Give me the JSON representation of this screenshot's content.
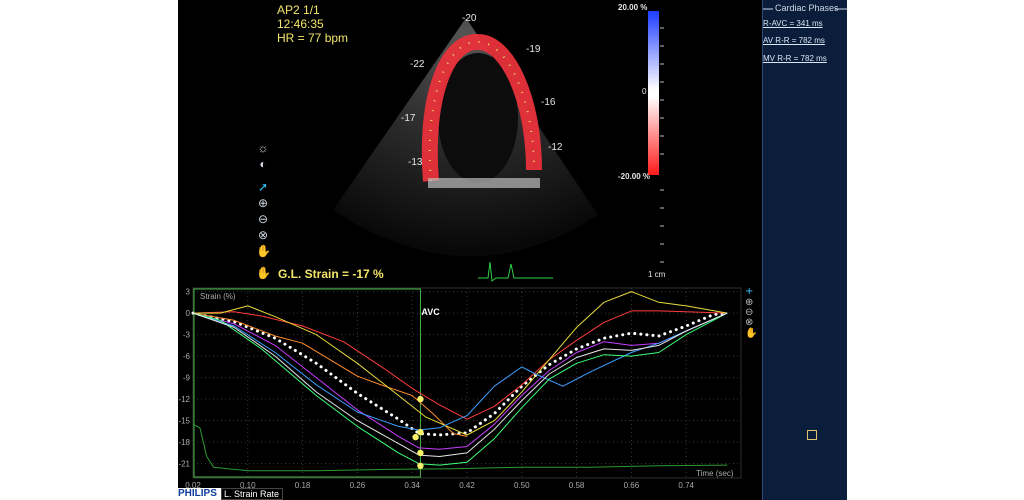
{
  "header": {
    "view": "AP2  1/1",
    "time": "12:46:35",
    "hr": "HR = 77 bpm"
  },
  "segments": [
    "-20",
    "-19",
    "-22",
    "-16",
    "-17",
    "-12",
    "-13"
  ],
  "colorbar": {
    "max_label": "20.00 %",
    "mid_label": "0",
    "min_label": "-20.00 %",
    "top_color": "#1e3cff",
    "bottom_color": "#ff1a1a"
  },
  "scale_label": "1 cm",
  "gls": "G.L. Strain = -17 %",
  "tools": [
    "brightness-icon",
    "contrast-icon",
    "pointer-icon",
    "zoom-in-icon",
    "zoom-out-icon",
    "reset-icon",
    "pan-hand-icon"
  ],
  "chart_data": {
    "type": "line",
    "ylabel": "Strain (%)",
    "xlabel": "Time (sec)",
    "avc_label": "AVC",
    "avc_x": 0.352,
    "xlim": [
      0.02,
      0.82
    ],
    "ylim": [
      -23,
      3.5
    ],
    "x_ticks": [
      "0.02",
      "0.10",
      "0.18",
      "0.26",
      "0.34",
      "0.42",
      "0.50",
      "0.58",
      "0.66",
      "0.74"
    ],
    "y_ticks": [
      "3",
      "0",
      "-3",
      "-6",
      "-9",
      "-12",
      "-15",
      "-18",
      "-21"
    ],
    "series": [
      {
        "color": "#ffffff",
        "dotted": true,
        "points": [
          [
            0.02,
            0
          ],
          [
            0.08,
            -1.2
          ],
          [
            0.14,
            -3.5
          ],
          [
            0.2,
            -7
          ],
          [
            0.26,
            -11.2
          ],
          [
            0.32,
            -14.8
          ],
          [
            0.35,
            -16.8
          ],
          [
            0.38,
            -17
          ],
          [
            0.42,
            -16.7
          ],
          [
            0.46,
            -14
          ],
          [
            0.5,
            -10.2
          ],
          [
            0.54,
            -7.2
          ],
          [
            0.58,
            -5
          ],
          [
            0.62,
            -3.5
          ],
          [
            0.66,
            -2.8
          ],
          [
            0.7,
            -3.2
          ],
          [
            0.74,
            -1.8
          ],
          [
            0.78,
            -0.2
          ],
          [
            0.8,
            0
          ]
        ]
      },
      {
        "color": "#ff3c3c",
        "points": [
          [
            0.02,
            0
          ],
          [
            0.08,
            0.2
          ],
          [
            0.12,
            -0.4
          ],
          [
            0.18,
            -1.8
          ],
          [
            0.24,
            -4
          ],
          [
            0.3,
            -7.8
          ],
          [
            0.34,
            -10.5
          ],
          [
            0.38,
            -12.8
          ],
          [
            0.42,
            -14.8
          ],
          [
            0.46,
            -13
          ],
          [
            0.5,
            -10
          ],
          [
            0.54,
            -6.5
          ],
          [
            0.58,
            -3.8
          ],
          [
            0.62,
            -1.3
          ],
          [
            0.66,
            0.3
          ],
          [
            0.7,
            0.3
          ],
          [
            0.74,
            0.2
          ],
          [
            0.8,
            0
          ]
        ]
      },
      {
        "color": "#ff8c2a",
        "points": [
          [
            0.02,
            0
          ],
          [
            0.08,
            -1
          ],
          [
            0.14,
            -3.2
          ],
          [
            0.18,
            -4.2
          ],
          [
            0.22,
            -6.5
          ],
          [
            0.26,
            -8.8
          ],
          [
            0.3,
            -10.2
          ],
          [
            0.34,
            -11.5
          ],
          [
            0.37,
            -14
          ],
          [
            0.4,
            -16.8
          ],
          [
            0.42,
            -17.2
          ]
        ]
      },
      {
        "color": "#e8dc3c",
        "points": [
          [
            0.02,
            0
          ],
          [
            0.06,
            0
          ],
          [
            0.1,
            1
          ],
          [
            0.14,
            -0.5
          ],
          [
            0.2,
            -3
          ],
          [
            0.26,
            -7
          ],
          [
            0.32,
            -11.5
          ],
          [
            0.36,
            -14.5
          ],
          [
            0.42,
            -17
          ],
          [
            0.46,
            -15
          ],
          [
            0.5,
            -11
          ],
          [
            0.54,
            -6.5
          ],
          [
            0.58,
            -2
          ],
          [
            0.62,
            1.5
          ],
          [
            0.66,
            3
          ],
          [
            0.7,
            1.5
          ],
          [
            0.74,
            1
          ],
          [
            0.8,
            0
          ]
        ]
      },
      {
        "color": "#c83cff",
        "points": [
          [
            0.02,
            0
          ],
          [
            0.08,
            -1.5
          ],
          [
            0.14,
            -4.5
          ],
          [
            0.2,
            -9
          ],
          [
            0.26,
            -13.5
          ],
          [
            0.32,
            -17.2
          ],
          [
            0.35,
            -18.8
          ],
          [
            0.38,
            -19
          ],
          [
            0.42,
            -18.6
          ],
          [
            0.46,
            -15.5
          ],
          [
            0.5,
            -11.5
          ],
          [
            0.54,
            -8
          ],
          [
            0.58,
            -5.5
          ],
          [
            0.62,
            -4
          ],
          [
            0.66,
            -4.5
          ],
          [
            0.7,
            -4.2
          ],
          [
            0.74,
            -2.5
          ],
          [
            0.8,
            0
          ]
        ]
      },
      {
        "color": "#3ca0ff",
        "points": [
          [
            0.02,
            0
          ],
          [
            0.08,
            -1.8
          ],
          [
            0.14,
            -5.5
          ],
          [
            0.2,
            -10
          ],
          [
            0.26,
            -13.8
          ],
          [
            0.32,
            -15.8
          ],
          [
            0.35,
            -16.3
          ],
          [
            0.38,
            -16
          ],
          [
            0.42,
            -14.3
          ],
          [
            0.46,
            -10.2
          ],
          [
            0.5,
            -7.5
          ],
          [
            0.52,
            -8.5
          ],
          [
            0.56,
            -10.2
          ],
          [
            0.6,
            -8.2
          ],
          [
            0.66,
            -5.5
          ],
          [
            0.7,
            -4.2
          ],
          [
            0.74,
            -2.5
          ],
          [
            0.8,
            0
          ]
        ]
      },
      {
        "color": "#3cff78",
        "points": [
          [
            0.02,
            0
          ],
          [
            0.06,
            -1
          ],
          [
            0.12,
            -5
          ],
          [
            0.2,
            -11.5
          ],
          [
            0.26,
            -15.8
          ],
          [
            0.32,
            -19.5
          ],
          [
            0.35,
            -21
          ],
          [
            0.38,
            -21.2
          ],
          [
            0.42,
            -20.8
          ],
          [
            0.46,
            -17.5
          ],
          [
            0.5,
            -13.2
          ],
          [
            0.54,
            -9.2
          ],
          [
            0.58,
            -7
          ],
          [
            0.62,
            -5.8
          ],
          [
            0.66,
            -6
          ],
          [
            0.7,
            -5.5
          ],
          [
            0.74,
            -3
          ],
          [
            0.8,
            0
          ]
        ]
      },
      {
        "color": "#e6e6e6",
        "points": [
          [
            0.02,
            0
          ],
          [
            0.08,
            -2
          ],
          [
            0.14,
            -6
          ],
          [
            0.2,
            -11
          ],
          [
            0.26,
            -15
          ],
          [
            0.32,
            -18.2
          ],
          [
            0.35,
            -19.8
          ],
          [
            0.38,
            -20
          ],
          [
            0.42,
            -19.5
          ],
          [
            0.46,
            -16.2
          ],
          [
            0.5,
            -12.2
          ],
          [
            0.54,
            -8.5
          ],
          [
            0.58,
            -6.2
          ],
          [
            0.62,
            -5
          ],
          [
            0.66,
            -5.2
          ],
          [
            0.7,
            -4.5
          ],
          [
            0.74,
            -2.5
          ],
          [
            0.8,
            0
          ]
        ]
      },
      {
        "color": "#2e9a2e",
        "points": [
          [
            0.02,
            -15.5
          ],
          [
            0.03,
            -16
          ],
          [
            0.04,
            -20
          ],
          [
            0.05,
            -21.5
          ],
          [
            0.1,
            -22
          ],
          [
            0.2,
            -22
          ],
          [
            0.3,
            -21.8
          ],
          [
            0.4,
            -21.7
          ],
          [
            0.5,
            -21.5
          ],
          [
            0.6,
            -21.5
          ],
          [
            0.7,
            -21.3
          ],
          [
            0.8,
            -21.2
          ]
        ]
      }
    ],
    "markers": [
      {
        "x": 0.352,
        "y": -12,
        "color": "#f7f26a"
      },
      {
        "x": 0.352,
        "y": -16.6,
        "color": "#f7f26a"
      },
      {
        "x": 0.345,
        "y": -17.3,
        "color": "#f7f26a"
      },
      {
        "x": 0.352,
        "y": -19.5,
        "color": "#f7f26a"
      },
      {
        "x": 0.352,
        "y": -21.3,
        "color": "#f7f26a"
      }
    ]
  },
  "sidebar": {
    "title": "Cardiac Phases",
    "items": [
      "R-AVC = 341 ms",
      "AV R-R = 782 ms",
      "MV R-R = 782 ms"
    ]
  },
  "footer": {
    "brand": "PHILIPS",
    "mode_tab": "L. Strain Rate"
  }
}
